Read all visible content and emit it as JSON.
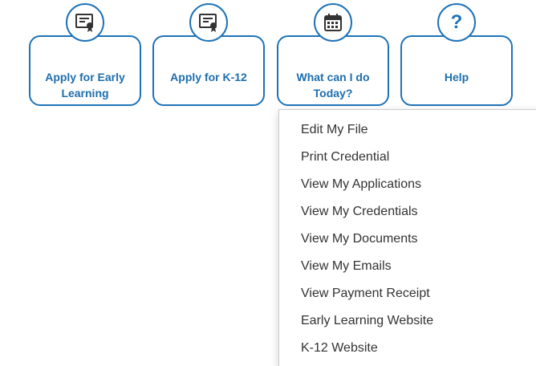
{
  "nav": {
    "tiles": [
      {
        "label": "Apply for Early Learning",
        "icon": "certificate-icon"
      },
      {
        "label": "Apply for K-12",
        "icon": "certificate-icon"
      },
      {
        "label": "What can I do Today?",
        "icon": "calendar-icon"
      },
      {
        "label": "Help",
        "icon": "question-icon",
        "glyph": "?"
      }
    ]
  },
  "menu": {
    "items": [
      "Edit My File",
      "Print Credential",
      "View My Applications",
      "View My Credentials",
      "View My Documents",
      "View My Emails",
      "View Payment Receipt",
      "Early Learning Website",
      "K-12 Website"
    ]
  },
  "colors": {
    "accent": "#1e73b8",
    "menu_text": "#333333"
  }
}
